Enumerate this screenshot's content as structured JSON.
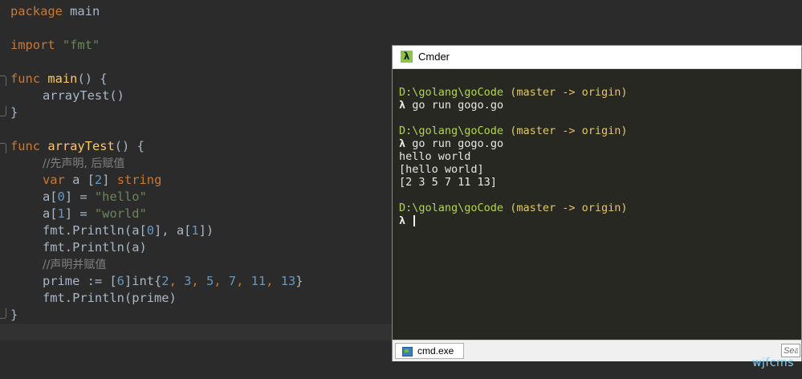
{
  "editor": {
    "lines": {
      "l1": [
        "package",
        "main"
      ],
      "l3": [
        "import",
        "\"fmt\""
      ],
      "l5": [
        "func",
        "main",
        "() {"
      ],
      "l6": "arrayTest()",
      "l7": "}",
      "l9": [
        "func",
        "arrayTest",
        "() {"
      ],
      "l10": "//先声明, 后赋值",
      "l11": [
        "var",
        "a [",
        "2",
        "] ",
        "string"
      ],
      "l12": [
        "a[",
        "0",
        "] = ",
        "\"hello\""
      ],
      "l13": [
        "a[",
        "1",
        "] = ",
        "\"world\""
      ],
      "l14": [
        "fmt.Println(a[",
        "0",
        "], a[",
        "1",
        "])"
      ],
      "l15": "fmt.Println(a)",
      "l16": "//声明并赋值",
      "l17": [
        "prime := [",
        "6",
        "]int{",
        "2",
        ", ",
        "3",
        ", ",
        "5",
        ", ",
        "7",
        ", ",
        "11",
        ", ",
        "13",
        "}"
      ],
      "l18": "fmt.Println(prime)",
      "l19": "}"
    }
  },
  "cmder": {
    "title": "Cmder",
    "logo": "λ",
    "terminal": {
      "path": "D:\\golang\\goCode",
      "branch": "(master -> origin)",
      "lambda": "λ",
      "cmd1": "go run gogo.go",
      "cmd2": "go run gogo.go",
      "out1": "hello world",
      "out2": "[hello world]",
      "out3": "[2 3 5 7 11 13]"
    },
    "tab": {
      "label": "cmd.exe",
      "icon": "console-icon"
    },
    "search_placeholder": "Search"
  },
  "watermark": "wjfcms",
  "colors": {
    "editor_bg": "#2b2b2b",
    "keyword": "#cc7832",
    "function": "#ffc66d",
    "string": "#6a8759",
    "number": "#6897bb",
    "comment": "#808080",
    "terminal_bg": "#272822",
    "terminal_path": "#b4d455",
    "terminal_branch": "#e2c76b"
  }
}
